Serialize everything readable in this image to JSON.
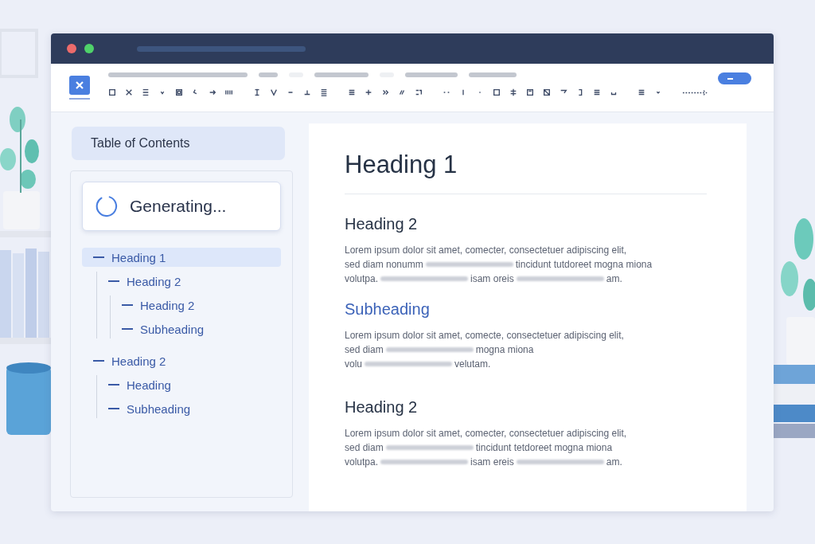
{
  "sidebar": {
    "title": "Table of Contents",
    "status": "Generating...",
    "toc": [
      {
        "label": "Heading 1",
        "selected": true,
        "children": [
          {
            "label": "Heading 2",
            "selected": false,
            "children": [
              {
                "label": "Heading 2",
                "selected": false
              },
              {
                "label": "Subheading",
                "selected": false
              }
            ]
          }
        ]
      },
      {
        "label": "Heading 2",
        "selected": false,
        "children": [
          {
            "label": "Heading",
            "selected": false
          },
          {
            "label": "Subheading",
            "selected": false
          }
        ]
      }
    ]
  },
  "document": {
    "title": "Heading 1",
    "sections": [
      {
        "kind": "heading",
        "heading": "Heading 2",
        "lines": [
          [
            {
              "kind": "text",
              "text": "Lorem ipsum dolor sit amet, comecter, consectetuer adipiscing elit,"
            }
          ],
          [
            {
              "kind": "text",
              "text": "sed diam nonumm"
            },
            {
              "kind": "blur"
            },
            {
              "kind": "text",
              "text": "tincidunt tutdoreet mogna miona"
            }
          ],
          [
            {
              "kind": "text",
              "text": "volutpa."
            },
            {
              "kind": "blur"
            },
            {
              "kind": "text",
              "text": "isam oreis"
            },
            {
              "kind": "blur"
            },
            {
              "kind": "text",
              "text": "am."
            }
          ]
        ]
      },
      {
        "kind": "subheading",
        "heading": "Subheading",
        "lines": [
          [
            {
              "kind": "text",
              "text": "Lorem ipsum dolor sit amet, comecte, consectetuer adipiscing elit,"
            }
          ],
          [
            {
              "kind": "text",
              "text": "sed diam"
            },
            {
              "kind": "blur"
            },
            {
              "kind": "text",
              "text": "mogna miona"
            }
          ],
          [
            {
              "kind": "text",
              "text": "volu"
            },
            {
              "kind": "blur"
            },
            {
              "kind": "text",
              "text": "velutam."
            }
          ]
        ]
      },
      {
        "kind": "heading",
        "heading": "Heading 2",
        "lines": [
          [
            {
              "kind": "text",
              "text": "Lorem ipsum dolor sit amet, comecter, consectetuer adipiscing elit,"
            }
          ],
          [
            {
              "kind": "text",
              "text": "sed diam"
            },
            {
              "kind": "blur"
            },
            {
              "kind": "text",
              "text": "tincidunt tetdoreet mogna miona"
            }
          ],
          [
            {
              "kind": "text",
              "text": "volutpa."
            },
            {
              "kind": "blur"
            },
            {
              "kind": "text",
              "text": "isam ereis"
            },
            {
              "kind": "blur"
            },
            {
              "kind": "text",
              "text": "am."
            }
          ]
        ]
      }
    ]
  }
}
